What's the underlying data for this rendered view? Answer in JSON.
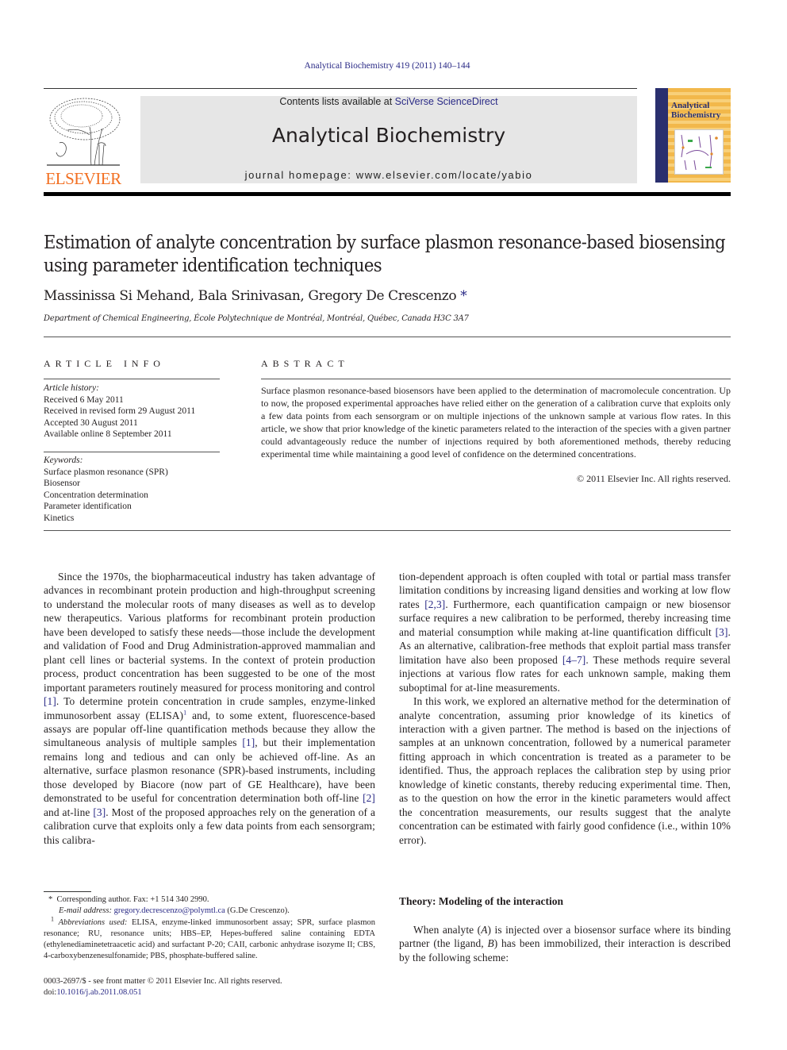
{
  "header": {
    "journal_ref": "Analytical Biochemistry 419 (2011) 140–144",
    "contents_prefix": "Contents lists available at ",
    "contents_link": "SciVerse ScienceDirect",
    "journal_title": "Analytical Biochemistry",
    "homepage_prefix": "journal homepage: ",
    "homepage_url": "www.elsevier.com/locate/yabio",
    "publisher_logo_text": "ELSEVIER",
    "cover": {
      "title_line1": "Analytical",
      "title_line2": "Biochemistry"
    },
    "colors": {
      "link": "#2a2a86",
      "elsevier_orange": "#f26f21",
      "band_grey": "#e6e6e6"
    }
  },
  "article": {
    "title": "Estimation of analyte concentration by surface plasmon resonance-based biosensing using parameter identification techniques",
    "authors": "Massinissa Si Mehand, Bala Srinivasan, Gregory De Crescenzo",
    "author_mark": "*",
    "affiliation": "Department of Chemical Engineering, École Polytechnique de Montréal, Montréal, Québec, Canada H3C 3A7"
  },
  "article_info": {
    "heading": "ARTICLE INFO",
    "history_label": "Article history:",
    "history": [
      "Received 6 May 2011",
      "Received in revised form 29 August 2011",
      "Accepted 30 August 2011",
      "Available online 8 September 2011"
    ],
    "keywords_label": "Keywords:",
    "keywords": [
      "Surface plasmon resonance (SPR)",
      "Biosensor",
      "Concentration determination",
      "Parameter identification",
      "Kinetics"
    ]
  },
  "abstract": {
    "heading": "ABSTRACT",
    "text": "Surface plasmon resonance-based biosensors have been applied to the determination of macromolecule concentration. Up to now, the proposed experimental approaches have relied either on the generation of a calibration curve that exploits only a few data points from each sensorgram or on multiple injections of the unknown sample at various flow rates. In this article, we show that prior knowledge of the kinetic parameters related to the interaction of the species with a given partner could advantageously reduce the number of injections required by both aforementioned methods, thereby reducing experimental time while maintaining a good level of confidence on the determined concentrations.",
    "copyright": "© 2011 Elsevier Inc. All rights reserved."
  },
  "body": {
    "left_p1_a": "Since the 1970s, the biopharmaceutical industry has taken advantage of advances in recombinant protein production and high-throughput screening to understand the molecular roots of many diseases as well as to develop new therapeutics. Various platforms for recombinant protein production have been developed to satisfy these needs—those include the development and validation of Food and Drug Administration-approved mammalian and plant cell lines or bacterial systems. In the context of protein production process, product concentration has been suggested to be one of the most important parameters routinely measured for process monitoring and control ",
    "ref1": "[1]",
    "left_p1_b": ". To determine protein concentration in crude samples, enzyme-linked immunosorbent assay (ELISA)",
    "fn_mark1": "1",
    "left_p1_c": " and, to some extent, fluorescence-based assays are popular off-line quantification methods because they allow the simultaneous analysis of multiple samples ",
    "ref1b": "[1]",
    "left_p1_d": ", but their implementation remains long and tedious and can only be achieved off-line. As an alternative, surface plasmon resonance (SPR)-based instruments, including those developed by Biacore (now part of GE Healthcare), have been demonstrated to be useful for concentration determination both off-line ",
    "ref2": "[2]",
    "left_p1_e": " and at-line ",
    "ref3": "[3]",
    "left_p1_f": ". Most of the proposed approaches rely on the generation of a calibration curve that exploits only a few data points from each sensorgram; this calibra-",
    "right_p1_a": "tion-dependent approach is often coupled with total or partial mass transfer limitation conditions by increasing ligand densities and working at low flow rates ",
    "ref23": "[2,3]",
    "right_p1_b": ". Furthermore, each quantification campaign or new biosensor surface requires a new calibration to be performed, thereby increasing time and material consumption while making at-line quantification difficult ",
    "ref3b": "[3]",
    "right_p1_c": ". As an alternative, calibration-free methods that exploit partial mass transfer limitation have also been proposed ",
    "ref47": "[4–7]",
    "right_p1_d": ". These methods require several injections at various flow rates for each unknown sample, making them suboptimal for at-line measurements.",
    "right_p2": "In this work, we explored an alternative method for the determination of analyte concentration, assuming prior knowledge of its kinetics of interaction with a given partner. The method is based on the injections of samples at an unknown concentration, followed by a numerical parameter fitting approach in which concentration is treated as a parameter to be identified. Thus, the approach replaces the calibration step by using prior knowledge of kinetic constants, thereby reducing experimental time. Then, as to the question on how the error in the kinetic parameters would affect the concentration measurements, our results suggest that the analyte concentration can be estimated with fairly good confidence (i.e., within 10% error).",
    "section_heading": "Theory: Modeling of the interaction",
    "theory_a": "When analyte (",
    "theory_A": "A",
    "theory_b": ") is injected over a biosensor surface where its binding partner (the ligand, ",
    "theory_B": "B",
    "theory_c": ") has been immobilized, their interaction is described by the following scheme:"
  },
  "footnotes": {
    "star_mark": "*",
    "corresponding": "Corresponding author. Fax: +1 514 340 2990.",
    "email_label": "E-mail address: ",
    "email": "gregory.decrescenzo@polymtl.ca",
    "email_suffix": " (G.De Crescenzo).",
    "abbr_mark": "1",
    "abbr_label": "Abbreviations used:",
    "abbr_text": " ELISA, enzyme-linked immunosorbent assay; SPR, surface plasmon resonance; RU, resonance units; HBS–EP, Hepes-buffered saline containing EDTA (ethylenediaminetetraacetic acid) and surfactant P-20; CAII, carbonic anhydrase isozyme II; CBS, 4-carboxybenzenesulfonamide; PBS, phosphate-buffered saline.",
    "front_matter": "0003-2697/$ - see front matter © 2011 Elsevier Inc. All rights reserved.",
    "doi_label": "doi:",
    "doi": "10.1016/j.ab.2011.08.051"
  }
}
